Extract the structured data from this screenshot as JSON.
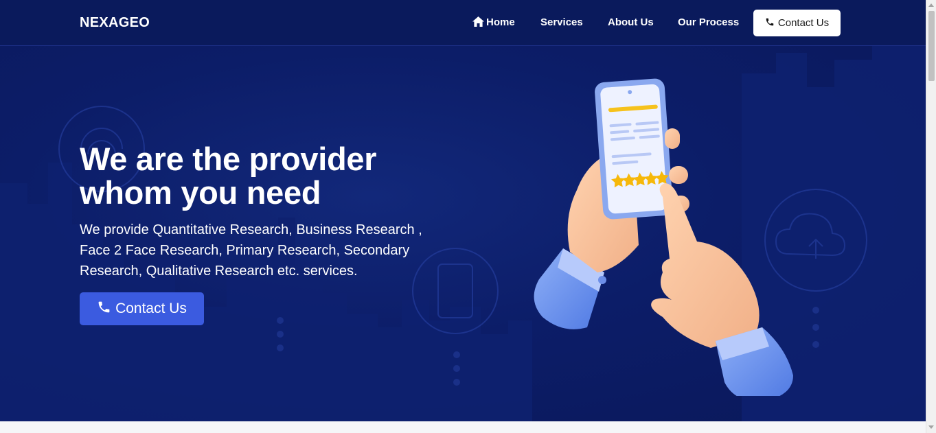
{
  "navbar": {
    "brand": "NEXAGEO",
    "links": {
      "home": "Home",
      "services": "Services",
      "about": "About Us",
      "process": "Our Process"
    },
    "contact_button": "Contact Us"
  },
  "hero": {
    "title_line1": "We are the provider",
    "title_line2": "whom you need",
    "description": "We provide Quantitative Research, Business Research , Face 2 Face Research, Primary Research, Secondary Research, Qualitative Research etc. services.",
    "cta_label": "Contact Us"
  },
  "icons": [
    "home-icon",
    "phone-icon",
    "cloud-upload-icon",
    "wifi-icon",
    "tablet-icon",
    "star-icon"
  ],
  "colors": {
    "nav_bg": "#0a1a5c",
    "hero_bg": "#0c1d68",
    "cta_bg": "#3b5be0",
    "rating_star": "#f6b80a"
  }
}
